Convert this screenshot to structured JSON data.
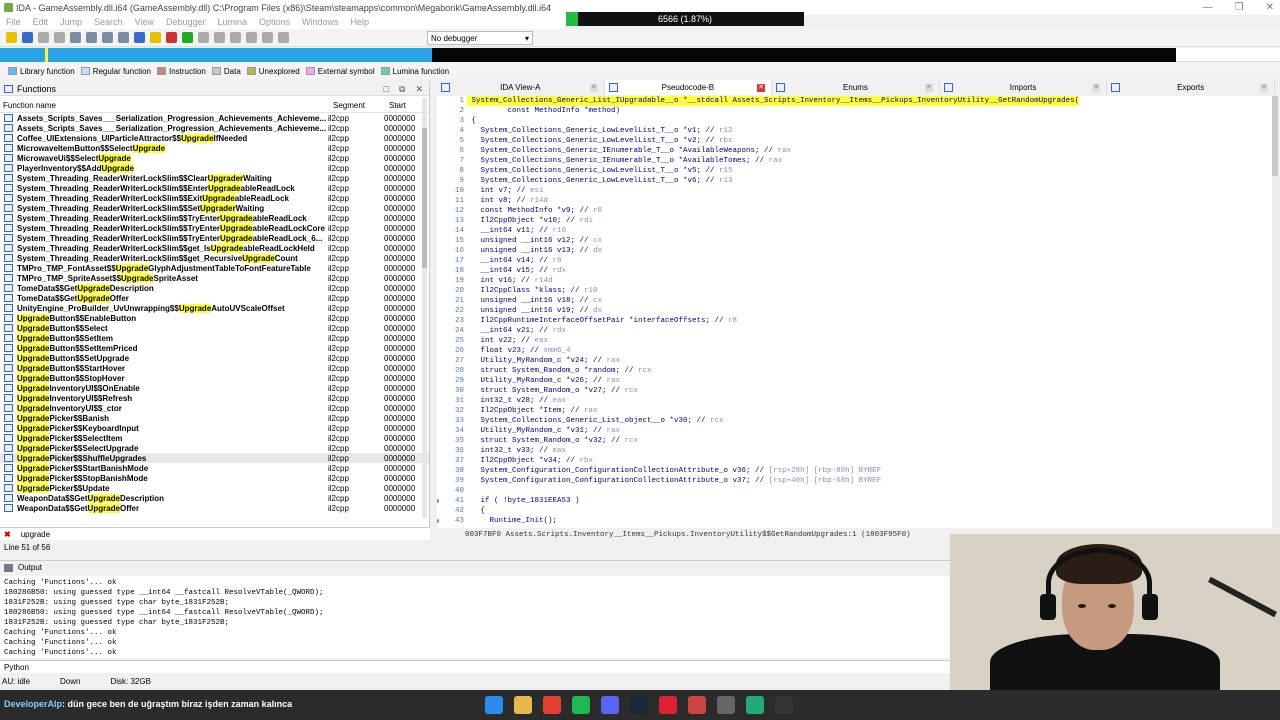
{
  "window": {
    "title": "IDA - GameAssembly.dll.i64 (GameAssembly.dll) C:\\Program Files (x86)\\Steam\\steamapps\\common\\Megabonk\\GameAssembly.dll.i64",
    "progress_text": "6566 (1.87%)",
    "progress_fraction": 0.0187
  },
  "menu": [
    "File",
    "Edit",
    "Jump",
    "Search",
    "View",
    "Debugger",
    "Lumina",
    "Options",
    "Windows",
    "Help"
  ],
  "toolbar": {
    "debugger_select": "No debugger"
  },
  "legend": [
    {
      "label": "Library function",
      "color": "#6cb6ff"
    },
    {
      "label": "Regular function",
      "color": "#c4dcff"
    },
    {
      "label": "Instruction",
      "color": "#c68a80"
    },
    {
      "label": "Data",
      "color": "#c8c8c8"
    },
    {
      "label": "Unexplored",
      "color": "#b7b84a"
    },
    {
      "label": "External symbol",
      "color": "#f7a3f0"
    },
    {
      "label": "Lumina function",
      "color": "#6dd1a5"
    }
  ],
  "functions_panel": {
    "title": "Functions",
    "columns": [
      "Function name",
      "Segment",
      "Start"
    ],
    "filter": "upgrade",
    "line_info": "Line 51 of 56",
    "rows": [
      {
        "pre": "Assets_Scripts_Saves___Serialization_Progression_Achievements_Achieveme...",
        "hl": "",
        "post": "",
        "seg": "il2cpp",
        "start": "0000000"
      },
      {
        "pre": "Assets_Scripts_Saves___Serialization_Progression_Achievements_Achieveme...",
        "hl": "",
        "post": "",
        "seg": "il2cpp",
        "start": "0000000"
      },
      {
        "pre": "Coffee_UIExtensions_UIParticleAttractor$$",
        "hl": "Upgrade",
        "post": "IfNeeded",
        "seg": "il2cpp",
        "start": "0000000"
      },
      {
        "pre": "MicrowaveItemButton$$Select",
        "hl": "Upgrade",
        "post": "",
        "seg": "il2cpp",
        "start": "0000000"
      },
      {
        "pre": "MicrowaveUi$$Select",
        "hl": "Upgrade",
        "post": "",
        "seg": "il2cpp",
        "start": "0000000"
      },
      {
        "pre": "PlayerInventory$$Add",
        "hl": "Upgrade",
        "post": "",
        "seg": "il2cpp",
        "start": "0000000"
      },
      {
        "pre": "System_Threading_ReaderWriterLockSlim$$Clear",
        "hl": "Upgrader",
        "post": "Waiting",
        "seg": "il2cpp",
        "start": "0000000"
      },
      {
        "pre": "System_Threading_ReaderWriterLockSlim$$Enter",
        "hl": "Upgrade",
        "post": "ableReadLock",
        "seg": "il2cpp",
        "start": "0000000"
      },
      {
        "pre": "System_Threading_ReaderWriterLockSlim$$Exit",
        "hl": "Upgrade",
        "post": "ableReadLock",
        "seg": "il2cpp",
        "start": "0000000"
      },
      {
        "pre": "System_Threading_ReaderWriterLockSlim$$Set",
        "hl": "Upgrader",
        "post": "Waiting",
        "seg": "il2cpp",
        "start": "0000000"
      },
      {
        "pre": "System_Threading_ReaderWriterLockSlim$$TryEnter",
        "hl": "Upgrade",
        "post": "ableReadLock",
        "seg": "il2cpp",
        "start": "0000000"
      },
      {
        "pre": "System_Threading_ReaderWriterLockSlim$$TryEnter",
        "hl": "Upgrade",
        "post": "ableReadLockCore",
        "seg": "il2cpp",
        "start": "0000000"
      },
      {
        "pre": "System_Threading_ReaderWriterLockSlim$$TryEnter",
        "hl": "Upgrade",
        "post": "ableReadLock_6...",
        "seg": "il2cpp",
        "start": "0000000"
      },
      {
        "pre": "System_Threading_ReaderWriterLockSlim$$get_Is",
        "hl": "Upgrade",
        "post": "ableReadLockHeld",
        "seg": "il2cpp",
        "start": "0000000"
      },
      {
        "pre": "System_Threading_ReaderWriterLockSlim$$get_Recursive",
        "hl": "Upgrade",
        "post": "Count",
        "seg": "il2cpp",
        "start": "0000000"
      },
      {
        "pre": "TMPro_TMP_FontAsset$$",
        "hl": "Upgrade",
        "post": "GlyphAdjustmentTableToFontFeatureTable",
        "seg": "il2cpp",
        "start": "0000000"
      },
      {
        "pre": "TMPro_TMP_SpriteAsset$$",
        "hl": "Upgrade",
        "post": "SpriteAsset",
        "seg": "il2cpp",
        "start": "0000000"
      },
      {
        "pre": "TomeData$$Get",
        "hl": "Upgrade",
        "post": "Description",
        "seg": "il2cpp",
        "start": "0000000"
      },
      {
        "pre": "TomeData$$Get",
        "hl": "Upgrade",
        "post": "Offer",
        "seg": "il2cpp",
        "start": "0000000"
      },
      {
        "pre": "UnityEngine_ProBuilder_UvUnwrapping$$",
        "hl": "Upgrade",
        "post": "AutoUVScaleOffset",
        "seg": "il2cpp",
        "start": "0000000"
      },
      {
        "pre": "",
        "hl": "Upgrade",
        "post": "Button$$EnableButton",
        "seg": "il2cpp",
        "start": "0000000"
      },
      {
        "pre": "",
        "hl": "Upgrade",
        "post": "Button$$Select",
        "seg": "il2cpp",
        "start": "0000000"
      },
      {
        "pre": "",
        "hl": "Upgrade",
        "post": "Button$$SetItem",
        "seg": "il2cpp",
        "start": "0000000"
      },
      {
        "pre": "",
        "hl": "Upgrade",
        "post": "Button$$SetItemPriced",
        "seg": "il2cpp",
        "start": "0000000"
      },
      {
        "pre": "",
        "hl": "Upgrade",
        "post": "Button$$SetUpgrade",
        "seg": "il2cpp",
        "start": "0000000"
      },
      {
        "pre": "",
        "hl": "Upgrade",
        "post": "Button$$StartHover",
        "seg": "il2cpp",
        "start": "0000000"
      },
      {
        "pre": "",
        "hl": "Upgrade",
        "post": "Button$$StopHover",
        "seg": "il2cpp",
        "start": "0000000"
      },
      {
        "pre": "",
        "hl": "Upgrade",
        "post": "InventoryUI$$OnEnable",
        "seg": "il2cpp",
        "start": "0000000"
      },
      {
        "pre": "",
        "hl": "Upgrade",
        "post": "InventoryUI$$Refresh",
        "seg": "il2cpp",
        "start": "0000000"
      },
      {
        "pre": "",
        "hl": "Upgrade",
        "post": "InventoryUI$$_ctor",
        "seg": "il2cpp",
        "start": "0000000"
      },
      {
        "pre": "",
        "hl": "Upgrade",
        "post": "Picker$$Banish",
        "seg": "il2cpp",
        "start": "0000000"
      },
      {
        "pre": "",
        "hl": "Upgrade",
        "post": "Picker$$KeyboardInput",
        "seg": "il2cpp",
        "start": "0000000"
      },
      {
        "pre": "",
        "hl": "Upgrade",
        "post": "Picker$$SelectItem",
        "seg": "il2cpp",
        "start": "0000000"
      },
      {
        "pre": "",
        "hl": "Upgrade",
        "post": "Picker$$SelectUpgrade",
        "seg": "il2cpp",
        "start": "0000000"
      },
      {
        "pre": "",
        "hl": "Upgrade",
        "post": "Picker$$ShuffleUpgrades",
        "seg": "il2cpp",
        "start": "0000000",
        "selected": true
      },
      {
        "pre": "",
        "hl": "Upgrade",
        "post": "Picker$$StartBanishMode",
        "seg": "il2cpp",
        "start": "0000000"
      },
      {
        "pre": "",
        "hl": "Upgrade",
        "post": "Picker$$StopBanishMode",
        "seg": "il2cpp",
        "start": "0000000"
      },
      {
        "pre": "",
        "hl": "Upgrade",
        "post": "Picker$$Update",
        "seg": "il2cpp",
        "start": "0000000"
      },
      {
        "pre": "WeaponData$$Get",
        "hl": "Upgrade",
        "post": "Description",
        "seg": "il2cpp",
        "start": "0000000"
      },
      {
        "pre": "WeaponData$$Get",
        "hl": "Upgrade",
        "post": "Offer",
        "seg": "il2cpp",
        "start": "0000000"
      }
    ]
  },
  "tabs": [
    {
      "label": "IDA View-A",
      "active": false
    },
    {
      "label": "Pseudocode-B",
      "active": true
    },
    {
      "label": "Enums",
      "active": false
    },
    {
      "label": "Imports",
      "active": false
    },
    {
      "label": "Exports",
      "active": false
    }
  ],
  "code_lines": [
    {
      "n": "1",
      "code": "System_Collections_Generic_List_IUpgradable__o *__stdcall Assets_Scripts_Inventory__Items__Pickups_InventoryUtility__GetRandomUpgrades(",
      "cm": ""
    },
    {
      "n": "2",
      "code": "        const MethodInfo *method)",
      "cm": ""
    },
    {
      "n": "3",
      "code": "{",
      "cm": ""
    },
    {
      "n": "4",
      "code": "  System_Collections_Generic_LowLevelList_T__o *v1; // ",
      "cm": "r12"
    },
    {
      "n": "5",
      "code": "  System_Collections_Generic_LowLevelList_T__o *v2; // ",
      "cm": "rbx"
    },
    {
      "n": "6",
      "code": "  System_Collections_Generic_IEnumerable_T__o *AvailableWeapons; // ",
      "cm": "rax"
    },
    {
      "n": "7",
      "code": "  System_Collections_Generic_IEnumerable_T__o *AvailableTomes; // ",
      "cm": "rax"
    },
    {
      "n": "8",
      "code": "  System_Collections_Generic_LowLevelList_T__o *v5; // ",
      "cm": "r15"
    },
    {
      "n": "9",
      "code": "  System_Collections_Generic_LowLevelList_T__o *v6; // ",
      "cm": "r13"
    },
    {
      "n": "10",
      "code": "  int v7; // ",
      "cm": "esi"
    },
    {
      "n": "11",
      "code": "  int v8; // ",
      "cm": "r14d"
    },
    {
      "n": "12",
      "code": "  const MethodInfo *v9; // ",
      "cm": "r8"
    },
    {
      "n": "13",
      "code": "  Il2CppObject *v10; // ",
      "cm": "rdi"
    },
    {
      "n": "14",
      "code": "  __int64 v11; // ",
      "cm": "r10"
    },
    {
      "n": "15",
      "code": "  unsigned __int16 v12; // ",
      "cm": "cx"
    },
    {
      "n": "16",
      "code": "  unsigned __int16 v13; // ",
      "cm": "dx"
    },
    {
      "n": "17",
      "code": "  __int64 v14; // ",
      "cm": "r8"
    },
    {
      "n": "18",
      "code": "  __int64 v15; // ",
      "cm": "rdx"
    },
    {
      "n": "19",
      "code": "  int v16; // ",
      "cm": "r14d"
    },
    {
      "n": "20",
      "code": "  Il2CppClass *klass; // ",
      "cm": "r10"
    },
    {
      "n": "21",
      "code": "  unsigned __int16 v18; // ",
      "cm": "cx"
    },
    {
      "n": "22",
      "code": "  unsigned __int16 v19; // ",
      "cm": "dx"
    },
    {
      "n": "23",
      "code": "  Il2CppRuntimeInterfaceOffsetPair *interfaceOffsets; // ",
      "cm": "r8"
    },
    {
      "n": "24",
      "code": "  __int64 v21; // ",
      "cm": "rdx"
    },
    {
      "n": "25",
      "code": "  int v22; // ",
      "cm": "eax"
    },
    {
      "n": "26",
      "code": "  float v23; // ",
      "cm": "xmm6_4"
    },
    {
      "n": "27",
      "code": "  Utility_MyRandom_c *v24; // ",
      "cm": "rax"
    },
    {
      "n": "28",
      "code": "  struct System_Random_o *random; // ",
      "cm": "rcx"
    },
    {
      "n": "29",
      "code": "  Utility_MyRandom_c *v26; // ",
      "cm": "rax"
    },
    {
      "n": "30",
      "code": "  struct System_Random_o *v27; // ",
      "cm": "rcx"
    },
    {
      "n": "31",
      "code": "  int32_t v28; // ",
      "cm": "eax"
    },
    {
      "n": "32",
      "code": "  Il2CppObject *Item; // ",
      "cm": "rax"
    },
    {
      "n": "33",
      "code": "  System_Collections_Generic_List_object__o *v30; // ",
      "cm": "rcx"
    },
    {
      "n": "34",
      "code": "  Utility_MyRandom_c *v31; // ",
      "cm": "rax"
    },
    {
      "n": "35",
      "code": "  struct System_Random_o *v32; // ",
      "cm": "rcx"
    },
    {
      "n": "36",
      "code": "  int32_t v33; // ",
      "cm": "eax"
    },
    {
      "n": "37",
      "code": "  Il2CppObject *v34; // ",
      "cm": "rbx"
    },
    {
      "n": "38",
      "code": "  System_Configuration_ConfigurationCollectionAttribute_o v36; // ",
      "cm": "[rsp+28h] [rbp-80h] BYREF"
    },
    {
      "n": "39",
      "code": "  System_Configuration_ConfigurationCollectionAttribute_o v37; // ",
      "cm": "[rsp+40h] [rbp-68h] BYREF"
    },
    {
      "n": "40",
      "code": "",
      "cm": ""
    },
    {
      "n": "41",
      "code": "  if ( !byte_1831EEA53 )",
      "cm": "",
      "bp": true
    },
    {
      "n": "42",
      "code": "  {",
      "cm": ""
    },
    {
      "n": "43",
      "code": "    Runtime_Init();",
      "cm": "",
      "bp": true
    }
  ],
  "address_bar": "003F7BF0 Assets.Scripts.Inventory__Items__Pickups.InventoryUtility$$GetRandomUpgrades:1 (1803F95F0)",
  "output": {
    "title": "Output",
    "lines": [
      "Caching 'Functions'... ok",
      "180286B50: using guessed type __int64 __fastcall ResolveVTable(_QWORD);",
      "1831F252B: using guessed type char byte_1831F252B;",
      "180286B50: using guessed type __int64 __fastcall ResolveVTable(_QWORD);",
      "1831F252B: using guessed type char byte_1831F252B;",
      "Caching 'Functions'... ok",
      "Caching 'Functions'... ok",
      "Caching 'Functions'... ok"
    ],
    "interpreter": "Python"
  },
  "status": {
    "au": "AU:",
    "state": "idle",
    "direction": "Down",
    "disk": "Disk: 32GB"
  },
  "chat": {
    "user": "DeveloperAlp",
    "message": ": dün gece ben de uğraştım biraz işden zaman kalınca"
  },
  "taskbar_icons": [
    {
      "name": "windows-start-icon",
      "color": "#2b8cf0"
    },
    {
      "name": "file-explorer-icon",
      "color": "#e8b84a"
    },
    {
      "name": "chrome-icon",
      "color": "#e34133"
    },
    {
      "name": "spotify-icon",
      "color": "#1db954"
    },
    {
      "name": "discord-icon",
      "color": "#5865f2"
    },
    {
      "name": "steam-icon",
      "color": "#1b2838"
    },
    {
      "name": "red-app-icon",
      "color": "#d23"
    },
    {
      "name": "ida-icon",
      "color": "#c44"
    },
    {
      "name": "obs-icon",
      "color": "#666"
    },
    {
      "name": "green-app-icon",
      "color": "#2a7"
    },
    {
      "name": "terminal-icon",
      "color": "#333"
    }
  ]
}
